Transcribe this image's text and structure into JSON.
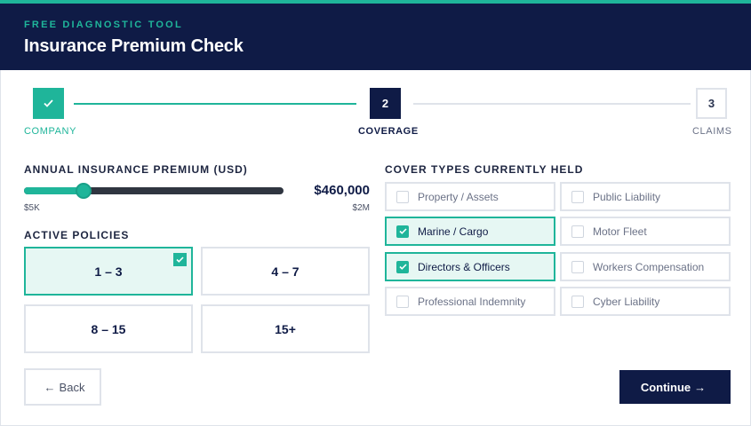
{
  "header": {
    "eyebrow": "FREE DIAGNOSTIC TOOL",
    "title": "Insurance Premium Check"
  },
  "stepper": {
    "steps": [
      {
        "label": "COMPANY",
        "marker": "✓",
        "state": "complete"
      },
      {
        "label": "COVERAGE",
        "marker": "2",
        "state": "active"
      },
      {
        "label": "CLAIMS",
        "marker": "3",
        "state": "upcoming"
      }
    ]
  },
  "premium": {
    "label": "ANNUAL INSURANCE PREMIUM (USD)",
    "value": "$460,000",
    "min_label": "$5K",
    "max_label": "$2M",
    "slider_fraction": 0.23
  },
  "policies": {
    "label": "ACTIVE POLICIES",
    "options": [
      {
        "label": "1 – 3",
        "selected": true
      },
      {
        "label": "4 – 7",
        "selected": false
      },
      {
        "label": "8 – 15",
        "selected": false
      },
      {
        "label": "15+",
        "selected": false
      }
    ]
  },
  "cover_types": {
    "label": "COVER TYPES CURRENTLY HELD",
    "options": [
      {
        "label": "Property / Assets",
        "checked": false
      },
      {
        "label": "Public Liability",
        "checked": false
      },
      {
        "label": "Marine / Cargo",
        "checked": true
      },
      {
        "label": "Motor Fleet",
        "checked": false
      },
      {
        "label": "Directors & Officers",
        "checked": true
      },
      {
        "label": "Workers Compensation",
        "checked": false
      },
      {
        "label": "Professional Indemnity",
        "checked": false
      },
      {
        "label": "Cyber Liability",
        "checked": false
      }
    ]
  },
  "actions": {
    "back_label": "Back",
    "continue_label": "Continue"
  },
  "colors": {
    "navy": "#0f1b46",
    "teal": "#1fb59a",
    "selected_bg": "#e6f7f3",
    "border": "#dfe3ea"
  }
}
